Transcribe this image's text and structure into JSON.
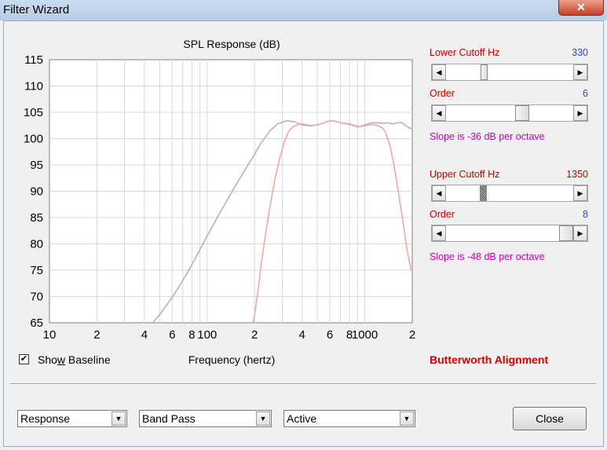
{
  "window": {
    "title": "Filter Wizard",
    "close_glyph": "✕"
  },
  "chart_data": {
    "type": "line",
    "title": "SPL Response (dB)",
    "xlabel": "Frequency (hertz)",
    "ylabel": "",
    "x_scale": "log",
    "xlim": [
      10,
      2000
    ],
    "ylim": [
      65,
      115
    ],
    "y_ticks": [
      65,
      70,
      75,
      80,
      85,
      90,
      95,
      100,
      105,
      110,
      115
    ],
    "x_tick_labels": [
      {
        "value": 10,
        "label": "10"
      },
      {
        "value": 20,
        "label": "2"
      },
      {
        "value": 40,
        "label": "4"
      },
      {
        "value": 60,
        "label": "6"
      },
      {
        "value": 80,
        "label": "8"
      },
      {
        "value": 100,
        "label": "100"
      },
      {
        "value": 200,
        "label": "2"
      },
      {
        "value": 400,
        "label": "4"
      },
      {
        "value": 600,
        "label": "6"
      },
      {
        "value": 800,
        "label": "8"
      },
      {
        "value": 1000,
        "label": "1000"
      },
      {
        "value": 2000,
        "label": "2"
      }
    ],
    "grid": true,
    "series": [
      {
        "color": "#b4b4b4",
        "x": [
          45,
          50,
          60,
          70,
          80,
          100,
          120,
          140,
          160,
          180,
          200,
          220,
          250,
          280,
          320,
          360,
          400,
          450,
          500,
          550,
          600,
          650,
          700,
          800,
          900,
          1000,
          1100,
          1200,
          1300,
          1400,
          1500,
          1700,
          1900,
          2000
        ],
        "y": [
          65,
          66.5,
          69.8,
          73,
          76,
          81.5,
          85.8,
          89.3,
          92.3,
          94.8,
          97,
          99.2,
          101.5,
          102.8,
          103.4,
          103.2,
          102.6,
          102.4,
          102.6,
          103,
          103.4,
          103.3,
          103,
          102.7,
          102.2,
          102.6,
          103,
          103,
          102.9,
          103,
          102.8,
          103.1,
          102.1,
          101.8
        ]
      },
      {
        "color": "#f0a8a8",
        "x": [
          196,
          200,
          210,
          220,
          235,
          250,
          270,
          290,
          310,
          330,
          360,
          400,
          450,
          500,
          550,
          600,
          650,
          700,
          800,
          900,
          1000,
          1100,
          1200,
          1300,
          1350,
          1450,
          1550,
          1650,
          1750,
          1850,
          1950,
          2000
        ],
        "y": [
          65,
          66.5,
          71,
          76,
          82,
          87,
          92.5,
          96.5,
          99.5,
          101.5,
          102.5,
          102.8,
          102.5,
          102.6,
          103,
          103.4,
          103.3,
          103,
          102.8,
          102.3,
          102.4,
          102.7,
          102.5,
          102,
          101.3,
          98.5,
          94,
          89,
          84,
          79,
          75.5,
          74.5
        ]
      }
    ]
  },
  "baseline": {
    "label_pre": "Sho",
    "label_accel": "w",
    "label_post": " Baseline",
    "checked": true,
    "check_glyph": "✔"
  },
  "lower": {
    "title": "Lower Cutoff  Hz",
    "value": "330",
    "position": 0.29,
    "order_label": "Order",
    "order_value": "6",
    "order_position": 0.61,
    "slope_text": "Slope is -36 dB per octave"
  },
  "upper": {
    "title": "Upper Cutoff  Hz",
    "value": "1350",
    "position": 0.28,
    "order_label": "Order",
    "order_value": "8",
    "order_position": 1.0,
    "slope_text": "Slope is -48 dB per octave"
  },
  "alignment_text": "Butterworth Alignment",
  "combos": {
    "view": "Response",
    "filter_type": "Band Pass",
    "mode": "Active"
  },
  "arrows": {
    "left": "◀",
    "right": "▶",
    "down": "▼"
  },
  "close_label": "Close",
  "colors": {
    "lower_title": "#c00000",
    "value_blue": "#2050c0",
    "slope": "#c000c0",
    "alignment": "#d00000"
  }
}
